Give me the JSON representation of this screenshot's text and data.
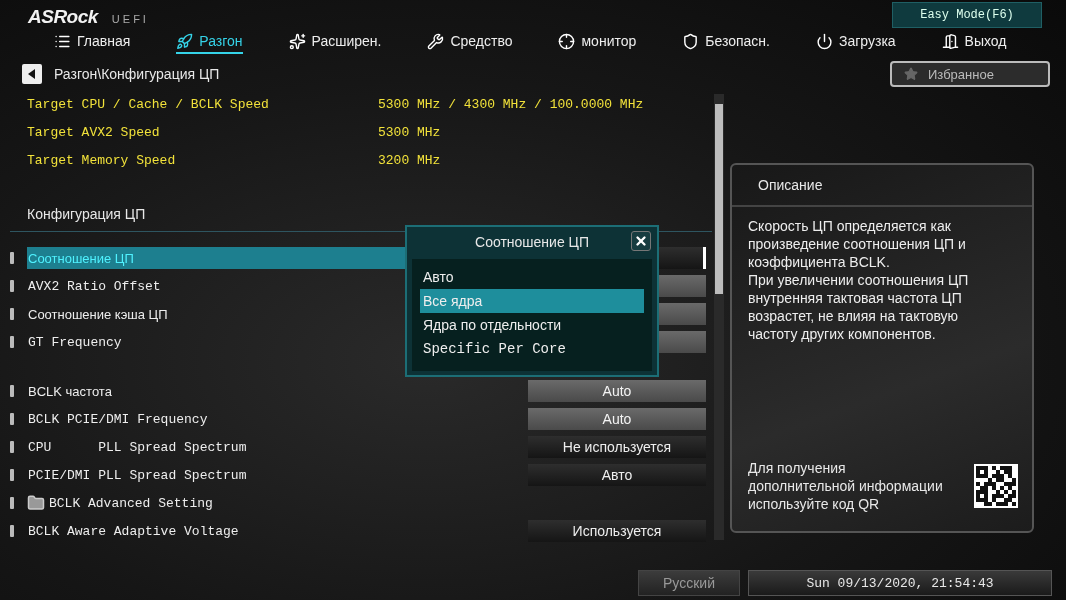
{
  "header": {
    "logo": "ASRock",
    "logo_sub": "UEFI",
    "easy_mode": "Easy Mode(F6)"
  },
  "tabs": [
    {
      "label": "Главная",
      "selected": false
    },
    {
      "label": "Разгон",
      "selected": true
    },
    {
      "label": "Расширен.",
      "selected": false
    },
    {
      "label": "Средство",
      "selected": false
    },
    {
      "label": "монитор",
      "selected": false
    },
    {
      "label": "Безопасн.",
      "selected": false
    },
    {
      "label": "Загрузка",
      "selected": false
    },
    {
      "label": "Выход",
      "selected": false
    }
  ],
  "breadcrumb": "Разгон\\Конфигурация ЦП",
  "favorites": "Избранное",
  "info_rows": [
    {
      "label": "Target CPU / Cache / BCLK Speed",
      "value": "5300 MHz / 4300 MHz / 100.0000 MHz"
    },
    {
      "label": "Target AVX2 Speed",
      "value": "5300 MHz"
    },
    {
      "label": "Target Memory Speed",
      "value": "3200 MHz"
    }
  ],
  "section_title": "Конфигурация ЦП",
  "settings": [
    {
      "kind": "setting",
      "label": "Соотношение ЦП",
      "selected": true,
      "disabled": false
    },
    {
      "kind": "setting",
      "label": "AVX2 Ratio Offset",
      "selected": false,
      "disabled": true
    },
    {
      "kind": "setting",
      "label": "Соотношение кэша ЦП",
      "selected": false,
      "disabled": true
    },
    {
      "kind": "setting",
      "label": "GT Frequency",
      "selected": false,
      "disabled": true
    },
    {
      "kind": "spacer"
    },
    {
      "kind": "setting",
      "label": "BCLK частота",
      "value": "Auto",
      "selected": false,
      "disabled": true
    },
    {
      "kind": "setting",
      "label": "BCLK PCIE/DMI Frequency",
      "value": "Auto",
      "selected": false,
      "disabled": true
    },
    {
      "kind": "setting",
      "label": "CPU      PLL Spread Spectrum",
      "value": "Не используется",
      "selected": false,
      "disabled": false
    },
    {
      "kind": "setting",
      "label": "PCIE/DMI PLL Spread Spectrum",
      "value": "Авто",
      "selected": false,
      "disabled": false
    },
    {
      "kind": "folder",
      "label": "BCLK Advanced Setting",
      "selected": false
    },
    {
      "kind": "setting",
      "label": "BCLK Aware Adaptive Voltage",
      "value": "Используется",
      "selected": false,
      "disabled": false
    }
  ],
  "popup": {
    "title": "Соотношение ЦП",
    "options": [
      {
        "label": "Авто",
        "selected": false
      },
      {
        "label": "Все ядра",
        "selected": true
      },
      {
        "label": "Ядра по отдельности",
        "selected": false
      },
      {
        "label": "Specific Per Core",
        "selected": false
      }
    ]
  },
  "description": {
    "title": "Описание",
    "paragraphs": [
      "Скорость ЦП определяется как произведение соотношения ЦП и коэффициента BCLK.",
      "При увеличении соотношения ЦП внутренняя тактовая частота ЦП возрастет, не влияя на тактовую частоту других компонентов."
    ],
    "qr_note": "Для получения дополнительной информации используйте код QR"
  },
  "status_bar": {
    "language": "Русский",
    "datetime": "Sun 09/13/2020, 21:54:43"
  }
}
